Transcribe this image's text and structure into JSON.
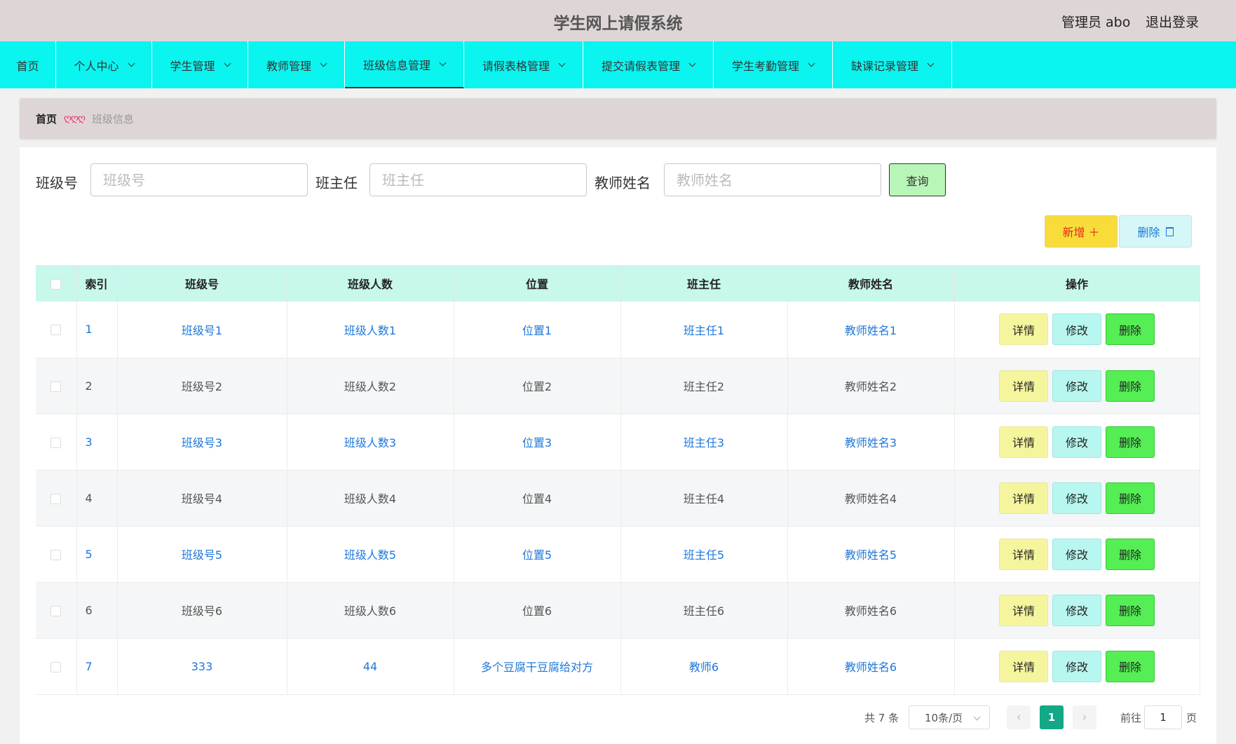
{
  "header": {
    "title": "学生网上请假系统",
    "admin_label": "管理员 abo",
    "logout_label": "退出登录"
  },
  "nav": {
    "items": [
      {
        "label": "首页"
      },
      {
        "label": "个人中心"
      },
      {
        "label": "学生管理"
      },
      {
        "label": "教师管理"
      },
      {
        "label": "班级信息管理"
      },
      {
        "label": "请假表格管理"
      },
      {
        "label": "提交请假表管理"
      },
      {
        "label": "学生考勤管理"
      },
      {
        "label": "缺课记录管理"
      }
    ],
    "active": "班级信息管理"
  },
  "breadcrumb": {
    "home": "首页",
    "separator": "ღღღ",
    "current": "班级信息"
  },
  "search": {
    "class_no_label": "班级号",
    "class_no_placeholder": "班级号",
    "head_teacher_label": "班主任",
    "head_teacher_placeholder": "班主任",
    "teacher_name_label": "教师姓名",
    "teacher_name_placeholder": "教师姓名",
    "query_label": "查询"
  },
  "actions": {
    "add_label": "新增 ＋",
    "delete_label": "删除"
  },
  "table": {
    "headers": [
      "索引",
      "班级号",
      "班级人数",
      "位置",
      "班主任",
      "教师姓名",
      "操作"
    ],
    "rows": [
      {
        "index": "1",
        "class_no": "班级号1",
        "count": "班级人数1",
        "location": "位置1",
        "head_teacher": "班主任1",
        "teacher_name": "教师姓名1"
      },
      {
        "index": "2",
        "class_no": "班级号2",
        "count": "班级人数2",
        "location": "位置2",
        "head_teacher": "班主任2",
        "teacher_name": "教师姓名2"
      },
      {
        "index": "3",
        "class_no": "班级号3",
        "count": "班级人数3",
        "location": "位置3",
        "head_teacher": "班主任3",
        "teacher_name": "教师姓名3"
      },
      {
        "index": "4",
        "class_no": "班级号4",
        "count": "班级人数4",
        "location": "位置4",
        "head_teacher": "班主任4",
        "teacher_name": "教师姓名4"
      },
      {
        "index": "5",
        "class_no": "班级号5",
        "count": "班级人数5",
        "location": "位置5",
        "head_teacher": "班主任5",
        "teacher_name": "教师姓名5"
      },
      {
        "index": "6",
        "class_no": "班级号6",
        "count": "班级人数6",
        "location": "位置6",
        "head_teacher": "班主任6",
        "teacher_name": "教师姓名6"
      },
      {
        "index": "7",
        "class_no": "333",
        "count": "44",
        "location": "多个豆腐干豆腐给对方",
        "head_teacher": "教师6",
        "teacher_name": "教师姓名6"
      }
    ],
    "op_detail": "详情",
    "op_edit": "修改",
    "op_delete": "删除"
  },
  "pagination": {
    "total": "共 7 条",
    "page_size": "10条/页",
    "current_page": "1",
    "goto_label": "前往",
    "goto_value": "1",
    "page_suffix": "页"
  },
  "colors": {
    "nav_bg": "#0af5f0",
    "header_bg": "#ded6d6",
    "table_header_bg": "#c8f7ec",
    "page_active": "#13a886"
  }
}
